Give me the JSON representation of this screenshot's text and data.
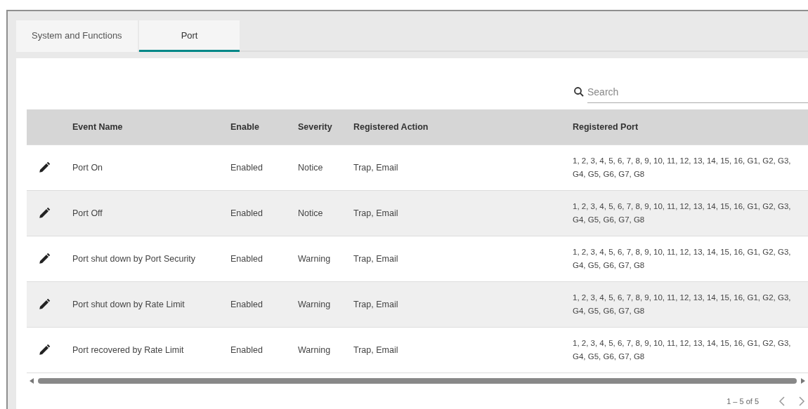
{
  "tabs": [
    {
      "label": "System and Functions",
      "selected": false
    },
    {
      "label": "Port",
      "selected": true
    }
  ],
  "search": {
    "placeholder": "Search"
  },
  "table": {
    "columns": [
      "Event Name",
      "Enable",
      "Severity",
      "Registered Action",
      "Registered Port"
    ],
    "rows": [
      {
        "event": "Port On",
        "enable": "Enabled",
        "severity": "Notice",
        "action": "Trap, Email",
        "ports": "1, 2, 3, 4, 5, 6, 7, 8, 9, 10, 11, 12, 13, 14, 15, 16, G1, G2, G3, G4, G5, G6, G7, G8"
      },
      {
        "event": "Port Off",
        "enable": "Enabled",
        "severity": "Notice",
        "action": "Trap, Email",
        "ports": "1, 2, 3, 4, 5, 6, 7, 8, 9, 10, 11, 12, 13, 14, 15, 16, G1, G2, G3, G4, G5, G6, G7, G8"
      },
      {
        "event": "Port shut down by Port Security",
        "enable": "Enabled",
        "severity": "Warning",
        "action": "Trap, Email",
        "ports": "1, 2, 3, 4, 5, 6, 7, 8, 9, 10, 11, 12, 13, 14, 15, 16, G1, G2, G3, G4, G5, G6, G7, G8"
      },
      {
        "event": "Port shut down by Rate Limit",
        "enable": "Enabled",
        "severity": "Warning",
        "action": "Trap, Email",
        "ports": "1, 2, 3, 4, 5, 6, 7, 8, 9, 10, 11, 12, 13, 14, 15, 16, G1, G2, G3, G4, G5, G6, G7, G8"
      },
      {
        "event": "Port recovered by Rate Limit",
        "enable": "Enabled",
        "severity": "Warning",
        "action": "Trap, Email",
        "ports": "1, 2, 3, 4, 5, 6, 7, 8, 9, 10, 11, 12, 13, 14, 15, 16, G1, G2, G3, G4, G5, G6, G7, G8"
      }
    ]
  },
  "pagination": {
    "range": "1 – 5 of 5"
  }
}
